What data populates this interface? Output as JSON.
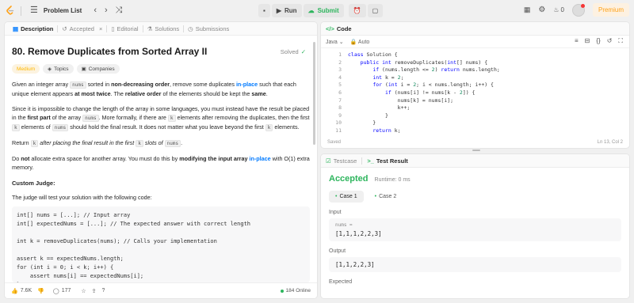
{
  "topbar": {
    "title": "Problem List",
    "run": "Run",
    "submit": "Submit",
    "streak": "0",
    "premium": "Premium"
  },
  "tabs": {
    "description": "Description",
    "accepted": "Accepted",
    "editorial": "Editorial",
    "solutions": "Solutions",
    "submissions": "Submissions"
  },
  "problem": {
    "title": "80. Remove Duplicates from Sorted Array II",
    "status": "Solved",
    "difficulty": "Medium",
    "topics": "Topics",
    "companies": "Companies",
    "p1": {
      "a": "Given an integer array ",
      "c1": "nums",
      "b": " sorted in ",
      "b_strong": "non-decreasing order",
      "c": ", remove some duplicates ",
      "inplace": "in-place",
      "d": " such that each unique element appears ",
      "d_strong": "at most twice",
      "e": ". The ",
      "e_strong": "relative order",
      "f": " of the elements should be kept the ",
      "f_strong": "same",
      "g": "."
    },
    "p2": {
      "a": "Since it is impossible to change the length of the array in some languages, you must instead have the result be placed in the ",
      "strong": "first part",
      "b": " of the array ",
      "c1": "nums",
      "c": ". More formally, if there are ",
      "c2": "k",
      "d": " elements after removing the duplicates, then the first ",
      "c3": "k",
      "e": " elements of ",
      "c4": "nums",
      "f": " should hold the final result. It does not matter what you leave beyond the first ",
      "c5": "k",
      "g": " elements."
    },
    "p3": {
      "a": "Return ",
      "c1": "k",
      "b": " after placing the final result in the first ",
      "c2": "k",
      "c": " slots of ",
      "c3": "nums",
      "d": "."
    },
    "p4": {
      "a": "Do ",
      "strong1": "not",
      "b": " allocate extra space for another array. You must do this by ",
      "strong2": "modifying the input array",
      "c": " ",
      "inplace": "in-place",
      "d": " with O(1) extra memory."
    },
    "custom_judge": "Custom Judge:",
    "p5": "The judge will test your solution with the following code:",
    "judge_code": "int[] nums = [...]; // Input array\nint[] expectedNums = [...]; // The expected answer with correct length\n\nint k = removeDuplicates(nums); // Calls your implementation\n\nassert k == expectedNums.length;\nfor (int i = 0; i < k; i++) {\n    assert nums[i] == expectedNums[i];\n}"
  },
  "footer": {
    "likes": "7.6K",
    "comments": "177",
    "online": "184 Online"
  },
  "code": {
    "header": "Code",
    "language": "Java",
    "mode": "Auto",
    "line_numbers": [
      "1",
      "2",
      "3",
      "4",
      "5",
      "6",
      "7",
      "8",
      "9",
      "10",
      "11"
    ],
    "saved": "Saved",
    "cursor": "Ln 13, Col 2"
  },
  "test": {
    "testcase_tab": "Testcase",
    "result_tab": "Test Result",
    "status": "Accepted",
    "runtime": "Runtime: 0 ms",
    "case1": "Case 1",
    "case2": "Case 2",
    "input_label": "Input",
    "input_var": "nums =",
    "input_value": "[1,1,1,2,2,3]",
    "output_label": "Output",
    "output_value": "[1,1,2,2,3]",
    "expected_label": "Expected"
  },
  "colors": {
    "accent": "#ffa116",
    "green": "#2db55d",
    "blue": "#007aff"
  }
}
